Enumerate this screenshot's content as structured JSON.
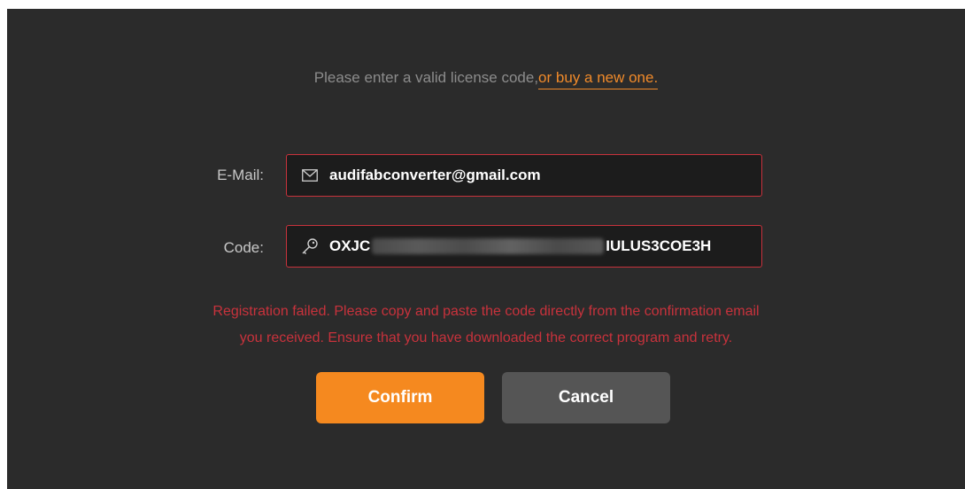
{
  "prompt": {
    "text": "Please enter a valid license code,",
    "link": "or buy a new one."
  },
  "email": {
    "label": "E-Mail:",
    "value": "audifabconverter@gmail.com",
    "icon": "mail-icon"
  },
  "code": {
    "label": "Code:",
    "value_start": "OXJC",
    "value_end": "IULUS3COE3H",
    "icon": "key-icon"
  },
  "error": {
    "line1": "Registration failed. Please copy and paste the code directly from the confirmation email",
    "line2": "you received. Ensure that you have downloaded the correct program and retry."
  },
  "buttons": {
    "confirm": "Confirm",
    "cancel": "Cancel"
  },
  "colors": {
    "background": "#2b2b2b",
    "accent": "#f5891f",
    "error": "#c8323c"
  }
}
